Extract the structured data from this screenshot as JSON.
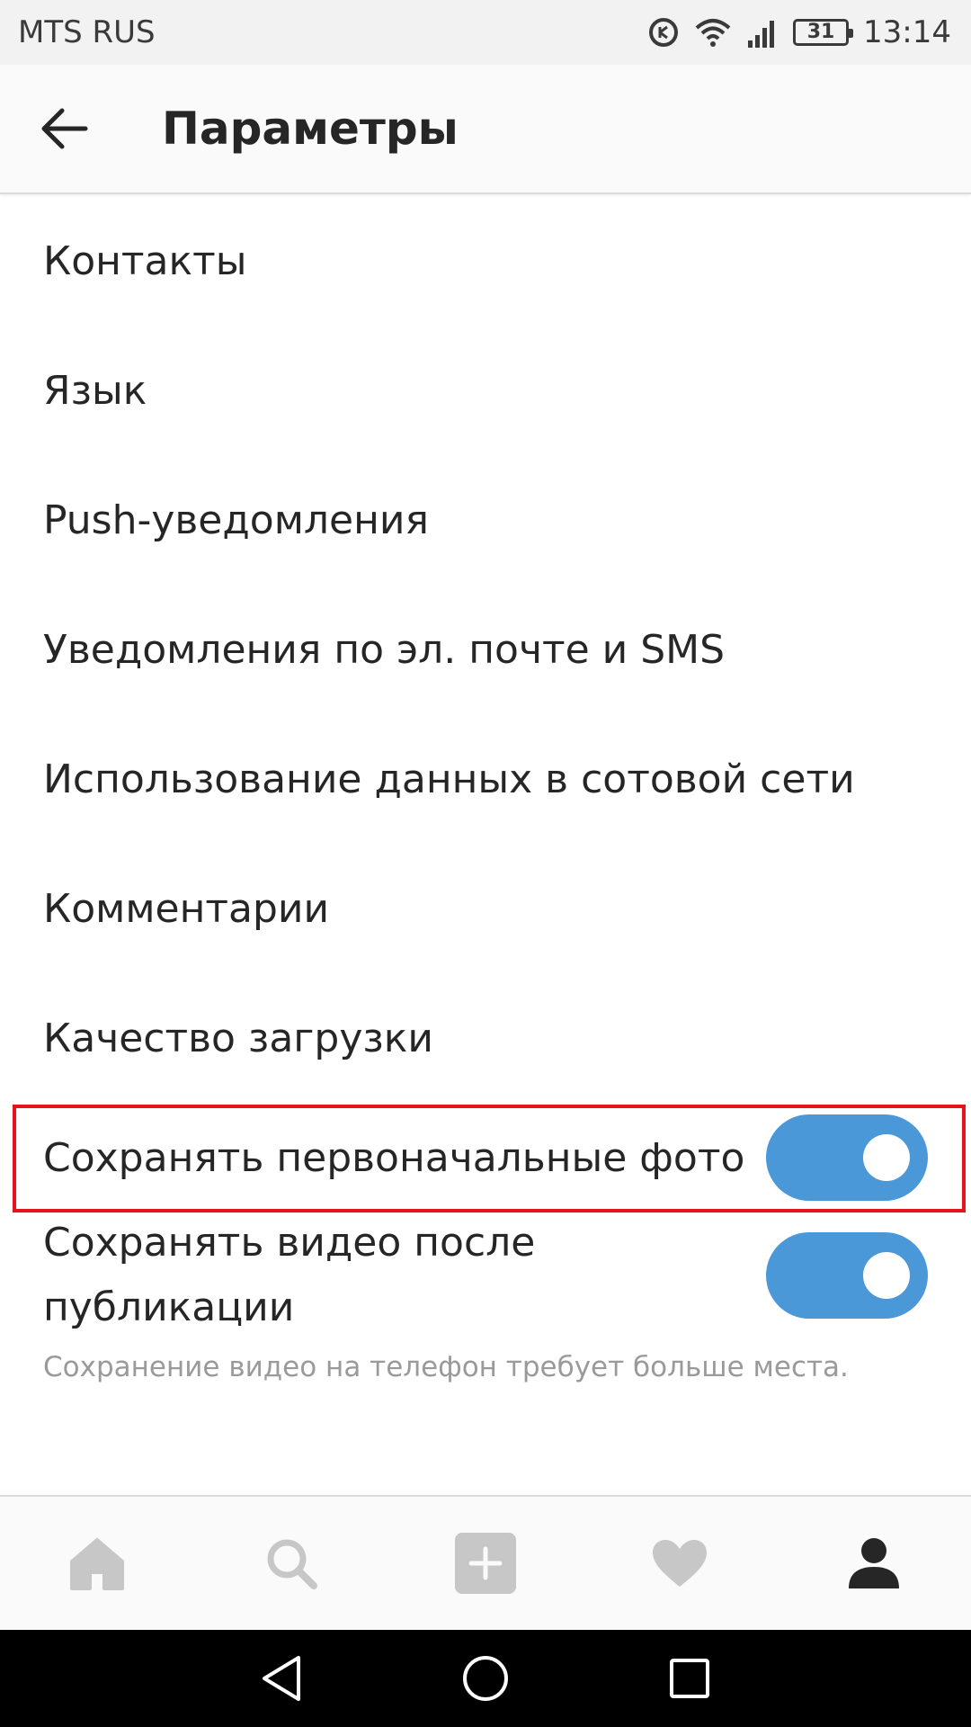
{
  "status_bar": {
    "carrier": "MTS RUS",
    "battery": "31",
    "time": "13:14",
    "icons": [
      "data-saver-icon",
      "wifi-icon",
      "signal-icon",
      "battery-icon"
    ]
  },
  "app_bar": {
    "title": "Параметры",
    "back_icon": "back-arrow-icon"
  },
  "settings": {
    "items": [
      {
        "label": "Контакты"
      },
      {
        "label": "Язык"
      },
      {
        "label": "Push-уведомления"
      },
      {
        "label": "Уведомления по эл. почте и SMS"
      },
      {
        "label": "Использование данных в сотовой сети"
      },
      {
        "label": "Комментарии"
      },
      {
        "label": "Качество загрузки"
      }
    ],
    "save_photos": {
      "label": "Сохранять первоначальные фото",
      "enabled": true
    },
    "save_videos": {
      "label": "Сохранять видео после публикации",
      "enabled": true,
      "caption": "Сохранение видео на телефон требует больше места."
    }
  },
  "colors": {
    "toggle_on": "#4a98d8",
    "highlight": "#e8141c",
    "text": "#262626",
    "caption": "#9a9a9a"
  },
  "tab_bar": {
    "tabs": [
      "home-icon",
      "search-icon",
      "add-post-icon",
      "activity-heart-icon",
      "profile-icon"
    ],
    "active": "profile-icon"
  },
  "nav_bar": {
    "buttons": [
      "back-triangle-icon",
      "home-circle-icon",
      "recents-square-icon"
    ]
  }
}
